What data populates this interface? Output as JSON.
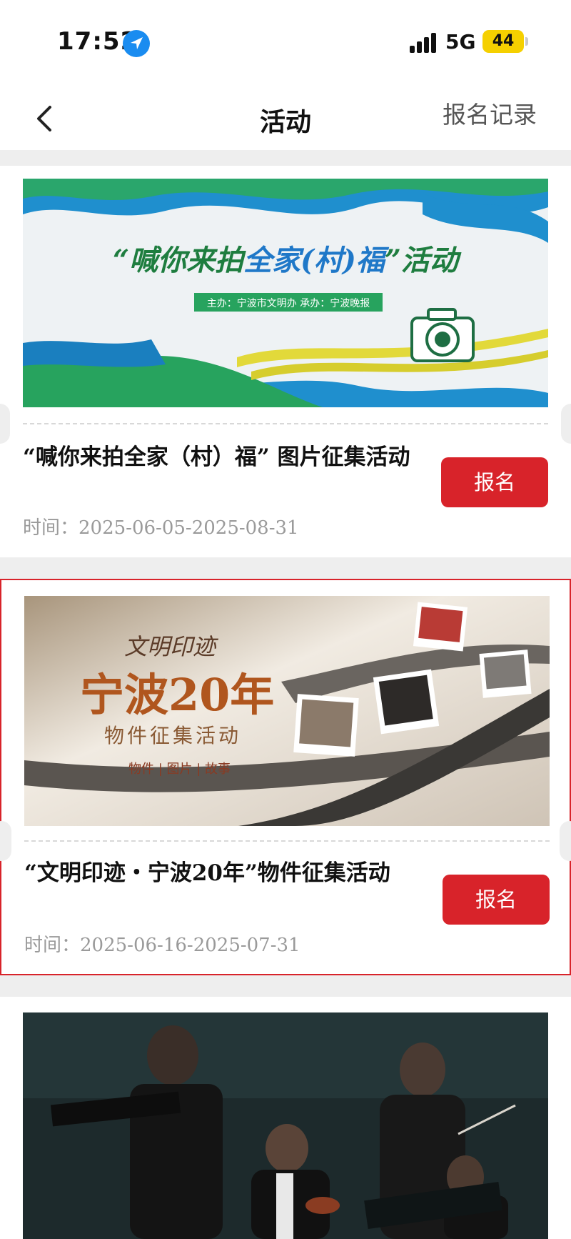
{
  "status_bar": {
    "time": "17:52",
    "network": "5G",
    "battery": "44",
    "location_icon": "location-arrow-icon",
    "signal_icon": "cellular-signal-icon"
  },
  "nav": {
    "back_icon": "chevron-left-icon",
    "title": "活动",
    "records_label": "报名记录"
  },
  "activities": [
    {
      "banner": {
        "headline_a": "“喊你来拍",
        "headline_b": "全家(村)福",
        "headline_c": "”活动",
        "sponsor_line": "主办：宁波市文明办   承办：宁波晚报",
        "icon": "camera-icon"
      },
      "title": "“喊你来拍全家（村）福” 图片征集活动",
      "time": "时间：2025-06-05-2025-08-31",
      "button_label": "报名"
    },
    {
      "banner": {
        "script_title": "文明印迹",
        "headline": "宁波20年",
        "subtitle": "物件征集活动",
        "tags": "物件 | 图片 | 故事"
      },
      "title": "“文明印迹・宁波20年”物件征集活动",
      "time": "时间：2025-06-16-2025-07-31",
      "button_label": "报名"
    },
    {
      "banner": {
        "description": "concert-photo"
      }
    }
  ],
  "colors": {
    "accent_red": "#d8232a",
    "page_bg": "#eeeeee",
    "battery_yellow": "#f5d000"
  }
}
